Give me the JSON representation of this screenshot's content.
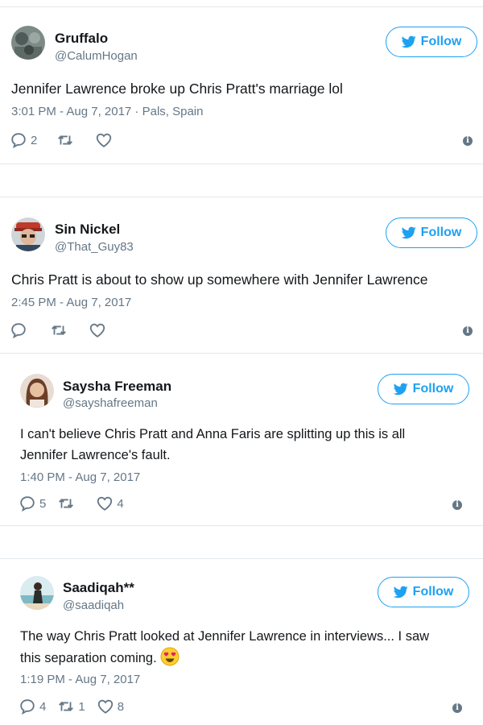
{
  "colors": {
    "accent": "#1da1f2",
    "text": "#14171a",
    "muted": "#657786",
    "divider": "#e1e8ed"
  },
  "follow_label": "Follow",
  "tweets": [
    {
      "name": "Gruffalo",
      "handle": "@CalumHogan",
      "text_lines": [
        "Jennifer Lawrence broke up Chris Pratt's marriage lol"
      ],
      "meta": "3:01 PM - Aug 7, 2017 · Pals, Spain",
      "replies": "2",
      "retweets": "",
      "likes": ""
    },
    {
      "name": "Sin Nickel",
      "handle": "@That_Guy83",
      "text_lines": [
        "Chris Pratt is about to show up somewhere with Jennifer Lawrence"
      ],
      "meta": "2:45 PM - Aug 7, 2017",
      "replies": "",
      "retweets": "",
      "likes": ""
    },
    {
      "name": "Saysha Freeman",
      "handle": "@sayshafreeman",
      "text_lines": [
        "I can't believe Chris Pratt and Anna Faris are splitting up this is all",
        "Jennifer Lawrence's fault."
      ],
      "meta": "1:40 PM - Aug 7, 2017",
      "replies": "5",
      "retweets": "",
      "likes": "4"
    },
    {
      "name": "Saadiqah**",
      "handle": "@saadiqah",
      "text_lines": [
        "The way Chris Pratt looked at Jennifer Lawrence in interviews... I saw",
        "this separation coming."
      ],
      "meta": "1:19 PM - Aug 7, 2017",
      "replies": "4",
      "retweets": "1",
      "likes": "8"
    }
  ]
}
